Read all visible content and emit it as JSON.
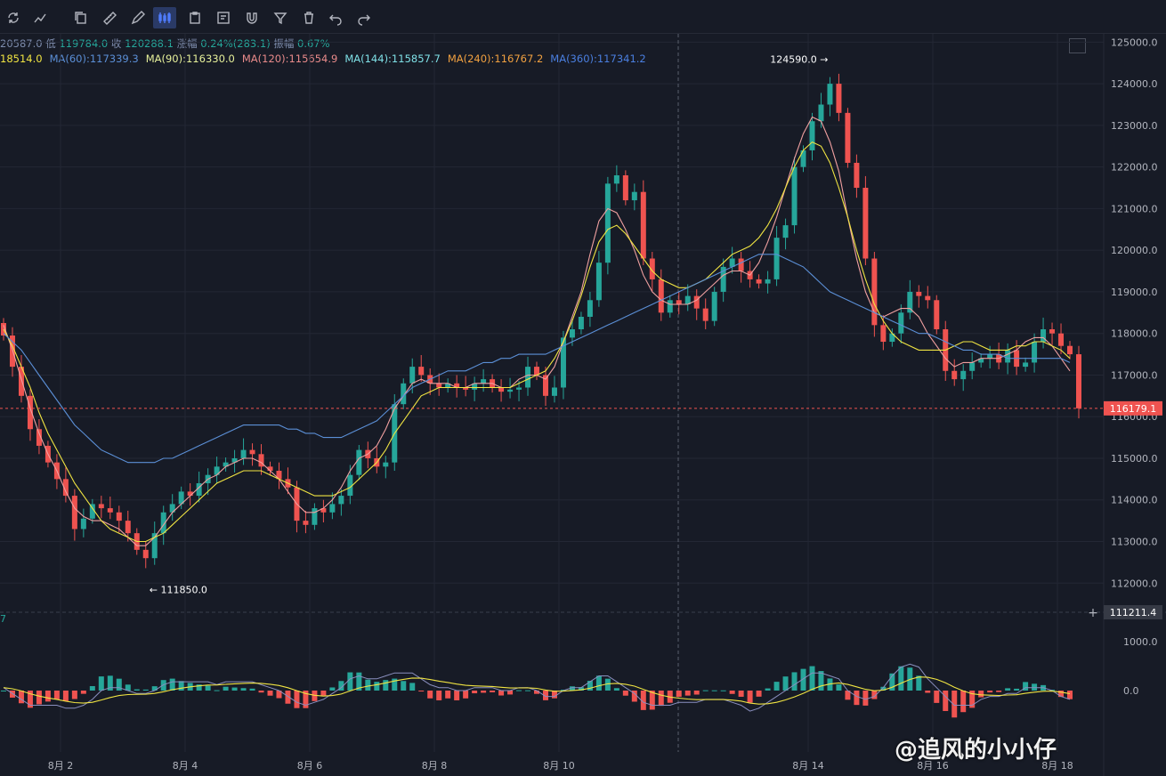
{
  "toolbar": {
    "tools": [
      {
        "name": "refresh-icon"
      },
      {
        "name": "indicator-icon"
      },
      {
        "name": "copy-icon"
      },
      {
        "name": "ruler-icon"
      },
      {
        "name": "pen-icon"
      },
      {
        "name": "candles-icon",
        "active": true
      },
      {
        "name": "clipboard-icon"
      },
      {
        "name": "note-icon"
      },
      {
        "name": "magnet-icon"
      },
      {
        "name": "filter-icon"
      },
      {
        "name": "trash-icon"
      },
      {
        "name": "undo-icon"
      },
      {
        "name": "redo-icon"
      }
    ]
  },
  "info": {
    "ohlc_prefix": "20587.0",
    "low_label": "低",
    "low": "119784.0",
    "close_label": "收",
    "close": "120288.1",
    "change_label": "涨幅",
    "change": "0.24%(283.1)",
    "amp_label": "振幅",
    "amp": "0.67%"
  },
  "ma_legend": [
    {
      "text": "18514.0",
      "color": "#f0e442"
    },
    {
      "text": "MA(60):117339.3",
      "color": "#5b8fd6"
    },
    {
      "text": "MA(90):116330.0",
      "color": "#e6f09a"
    },
    {
      "text": "MA(120):115654.9",
      "color": "#e88a8a"
    },
    {
      "text": "MA(144):115857.7",
      "color": "#7fe0e6"
    },
    {
      "text": "MA(240):116767.2",
      "color": "#f0a040"
    },
    {
      "text": "MA(360):117341.2",
      "color": "#4a7fe0"
    }
  ],
  "macd_label": "7",
  "watermark": "@追风的小小仔",
  "colors": {
    "up": "#26a69a",
    "down": "#ef5350",
    "bg": "#171b26",
    "grid": "#232734"
  },
  "chart_data": {
    "type": "candlestick",
    "x_ticks": [
      "8月 2",
      "8月 4",
      "8月 6",
      "8月 8",
      "8月 10",
      "8月 14",
      "8月 16",
      "8月 18"
    ],
    "y_ticks": [
      "112000.0",
      "113000.0",
      "114000.0",
      "115000.0",
      "116000.0",
      "117000.0",
      "118000.0",
      "119000.0",
      "120000.0",
      "121000.0",
      "122000.0",
      "123000.0",
      "124000.0",
      "125000.0"
    ],
    "ylim": [
      111300,
      125200
    ],
    "price_tags": [
      {
        "text": "116179.1",
        "color": "#ef5350"
      },
      {
        "text": "111211.4",
        "color": "#363a45"
      }
    ],
    "high_annotation": "124590.0",
    "low_annotation": "111850.0",
    "close_series": [
      117950,
      117200,
      116500,
      115700,
      115300,
      114900,
      114500,
      114100,
      113300,
      113550,
      113900,
      113800,
      113700,
      113500,
      113200,
      112800,
      112600,
      113200,
      113700,
      113900,
      114200,
      114100,
      114400,
      114600,
      114800,
      114900,
      115000,
      115200,
      115100,
      114800,
      114700,
      114500,
      114300,
      113500,
      113400,
      113800,
      113700,
      113900,
      114100,
      114600,
      115200,
      115000,
      114800,
      114900,
      116300,
      116800,
      117200,
      117000,
      116800,
      116700,
      116800,
      116700,
      116650,
      116800,
      116900,
      116700,
      116600,
      116650,
      116700,
      117200,
      117000,
      116500,
      116700,
      117900,
      118100,
      118400,
      118800,
      119700,
      121600,
      121800,
      121200,
      121400,
      119800,
      119300,
      118500,
      118800,
      118700,
      118900,
      118600,
      118300,
      119000,
      119600,
      119800,
      119500,
      119300,
      119200,
      119300,
      120300,
      120600,
      122000,
      122400,
      123100,
      123500,
      124000,
      123300,
      122100,
      121500,
      119800,
      118200,
      117800,
      118000,
      118500,
      119000,
      118900,
      118800,
      118100,
      117100,
      116900,
      117100,
      117300,
      117400,
      117500,
      117300,
      117600,
      117200,
      117300,
      117800,
      118100,
      118000,
      117700,
      117500,
      116200
    ],
    "ma_series": [
      {
        "name": "MA(7)",
        "color": "#f0a0a0",
        "values": [
          118200,
          117600,
          116900,
          116200,
          115600,
          115100,
          114700,
          114200,
          113800,
          113600,
          113500,
          113500,
          113400,
          113300,
          113100,
          112900,
          112900,
          113100,
          113400,
          113700,
          113900,
          114100,
          114300,
          114500,
          114600,
          114800,
          114900,
          115000,
          115000,
          114900,
          114700,
          114500,
          114200,
          113900,
          113700,
          113700,
          113800,
          114000,
          114300,
          114700,
          115000,
          115100,
          115300,
          115700,
          116200,
          116500,
          116800,
          116900,
          116800,
          116800,
          116800,
          116700,
          116700,
          116800,
          116800,
          116800,
          116700,
          116700,
          116900,
          117000,
          117000,
          116900,
          117200,
          117800,
          118400,
          119000,
          119900,
          120700,
          121000,
          120900,
          120500,
          120000,
          119400,
          119000,
          118800,
          118700,
          118700,
          118700,
          118800,
          119000,
          119200,
          119400,
          119500,
          119500,
          119400,
          119700,
          120200,
          120800,
          121500,
          122200,
          122800,
          123200,
          123100,
          122600,
          121900,
          120800,
          119800,
          119000,
          118500,
          118400,
          118500,
          118600,
          118600,
          118400,
          118000,
          117700,
          117400,
          117200,
          117300,
          117300,
          117400,
          117400,
          117400,
          117500,
          117600,
          117800,
          117900,
          117900,
          117700,
          117400,
          117100
        ]
      },
      {
        "name": "MA(25)",
        "color": "#f0e442",
        "values": [
          118100,
          117700,
          117200,
          116700,
          116100,
          115600,
          115200,
          114800,
          114400,
          114100,
          113800,
          113500,
          113300,
          113200,
          113100,
          113000,
          113000,
          113100,
          113200,
          113400,
          113600,
          113800,
          114000,
          114200,
          114400,
          114500,
          114600,
          114700,
          114700,
          114700,
          114600,
          114500,
          114400,
          114300,
          114200,
          114100,
          114100,
          114100,
          114200,
          114300,
          114500,
          114700,
          114900,
          115200,
          115600,
          115900,
          116200,
          116500,
          116600,
          116700,
          116700,
          116700,
          116700,
          116700,
          116700,
          116700,
          116700,
          116700,
          116800,
          116900,
          117000,
          117100,
          117400,
          117800,
          118300,
          118900,
          119600,
          120200,
          120500,
          120600,
          120400,
          120100,
          119800,
          119500,
          119300,
          119200,
          119100,
          119100,
          119200,
          119300,
          119500,
          119700,
          119900,
          120000,
          120100,
          120300,
          120600,
          121000,
          121500,
          122000,
          122400,
          122600,
          122500,
          122100,
          121500,
          120800,
          120000,
          119300,
          118700,
          118300,
          118000,
          117800,
          117700,
          117600,
          117600,
          117600,
          117600,
          117700,
          117800,
          117800,
          117700,
          117600,
          117600,
          117600,
          117700,
          117700,
          117800,
          117800,
          117700,
          117600,
          117400
        ]
      },
      {
        "name": "MA(60)",
        "color": "#5b8fd6",
        "values": [
          118000,
          117800,
          117600,
          117300,
          117000,
          116700,
          116400,
          116100,
          115800,
          115600,
          115400,
          115200,
          115100,
          115000,
          114900,
          114900,
          114900,
          114900,
          115000,
          115000,
          115100,
          115200,
          115300,
          115400,
          115500,
          115600,
          115700,
          115800,
          115800,
          115800,
          115800,
          115800,
          115700,
          115700,
          115600,
          115600,
          115500,
          115500,
          115500,
          115600,
          115700,
          115800,
          115900,
          116100,
          116300,
          116500,
          116700,
          116800,
          116900,
          117000,
          117100,
          117100,
          117100,
          117200,
          117300,
          117300,
          117400,
          117400,
          117500,
          117500,
          117500,
          117500,
          117600,
          117700,
          117800,
          117900,
          118000,
          118100,
          118200,
          118300,
          118400,
          118500,
          118600,
          118700,
          118800,
          118900,
          119000,
          119100,
          119200,
          119300,
          119400,
          119500,
          119600,
          119700,
          119800,
          119900,
          119900,
          119900,
          119800,
          119700,
          119600,
          119400,
          119200,
          119000,
          118900,
          118800,
          118700,
          118600,
          118500,
          118400,
          118300,
          118200,
          118100,
          118000,
          118000,
          117900,
          117800,
          117700,
          117600,
          117600,
          117500,
          117500,
          117500,
          117400,
          117400,
          117400,
          117400,
          117400,
          117400,
          117400,
          117300
        ]
      }
    ]
  }
}
